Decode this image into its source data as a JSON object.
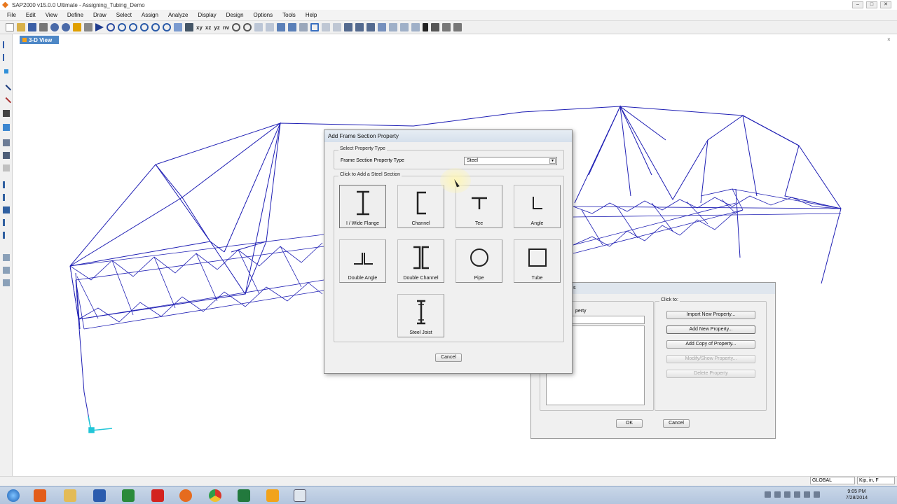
{
  "window": {
    "title": "SAP2000 v15.0.0 Ultimate - Assigning_Tubing_Demo",
    "controls": [
      "–",
      "□",
      "✕"
    ]
  },
  "menu": [
    "File",
    "Edit",
    "View",
    "Define",
    "Draw",
    "Select",
    "Assign",
    "Analyze",
    "Display",
    "Design",
    "Options",
    "Tools",
    "Help"
  ],
  "toolbar": {
    "view_buttons": [
      "xy",
      "xz",
      "yz",
      "nv"
    ]
  },
  "view_tab": {
    "label": "3-D View",
    "close_glyph": "×"
  },
  "status": {
    "coord_system": "GLOBAL",
    "units": "Kip, in, F"
  },
  "clock": {
    "time": "9:05 PM",
    "date": "7/28/2014"
  },
  "colors": {
    "frame": "#1f1fb4",
    "view_tab": "#4d87c6",
    "support": "#22c6d8"
  },
  "add_dialog": {
    "title": "Add Frame Section Property",
    "group1_label": "Select Property Type",
    "type_label": "Frame Section Property Type",
    "type_value": "Steel",
    "group2_label": "Click to Add a Steel Section",
    "sections": [
      {
        "label": "I / Wide Flange",
        "icon": "i-beam-icon"
      },
      {
        "label": "Channel",
        "icon": "channel-icon"
      },
      {
        "label": "Tee",
        "icon": "tee-icon"
      },
      {
        "label": "Angle",
        "icon": "angle-icon"
      },
      {
        "label": "Double Angle",
        "icon": "double-angle-icon"
      },
      {
        "label": "Double Channel",
        "icon": "double-channel-icon"
      },
      {
        "label": "Pipe",
        "icon": "pipe-icon"
      },
      {
        "label": "Tube",
        "icon": "tube-icon"
      },
      {
        "label": "Steel Joist",
        "icon": "steel-joist-icon"
      }
    ],
    "cancel": "Cancel"
  },
  "frame_props_dialog": {
    "title_fragment": "s",
    "list_header": "perty",
    "click_to": "Click to:",
    "buttons": [
      "Import New Property...",
      "Add New Property...",
      "Add Copy of Property...",
      "Modify/Show Property...",
      "Delete Property"
    ],
    "ok": "OK",
    "cancel": "Cancel"
  }
}
